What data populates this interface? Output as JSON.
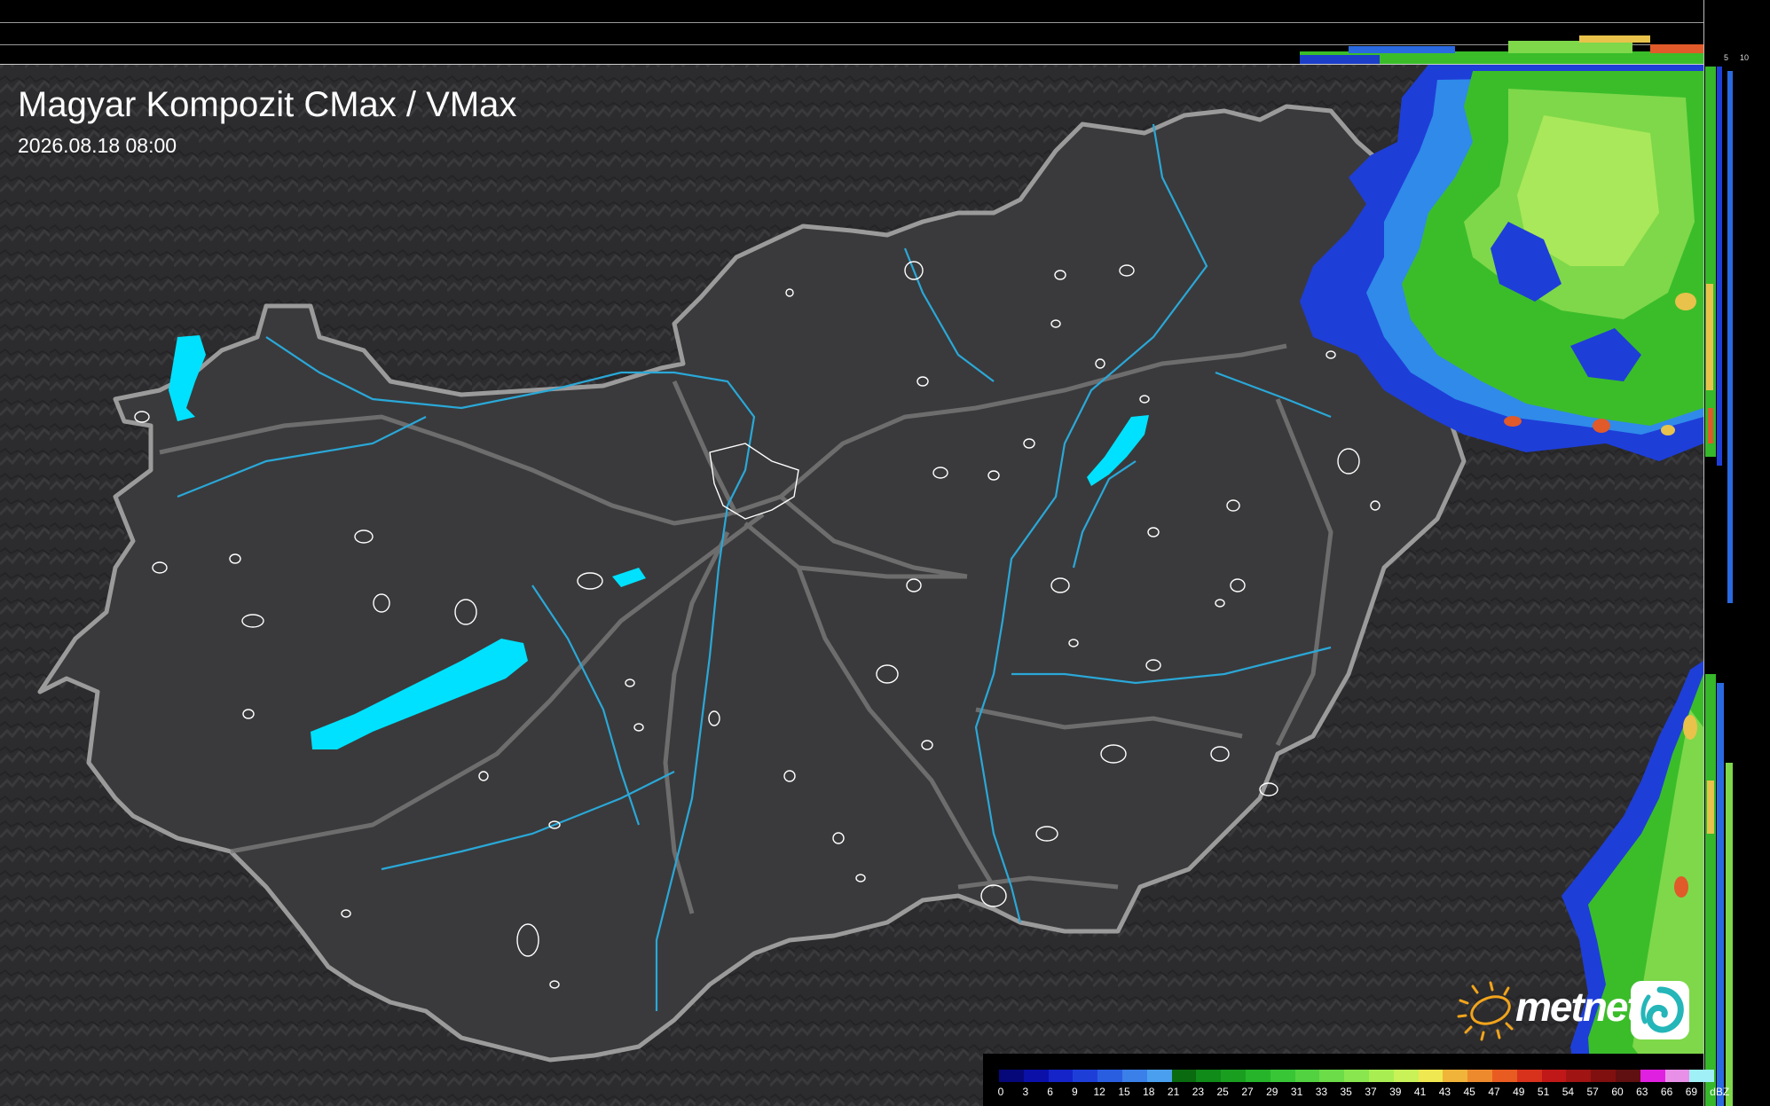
{
  "header": {
    "title": "Magyar Kompozit CMax / VMax",
    "timestamp": "2026.08.18 08:00"
  },
  "profile_axes": {
    "top_ticks": [
      "10",
      "5"
    ],
    "right_ticks": [
      "5",
      "10"
    ]
  },
  "brand": {
    "logo_text": "metnet"
  },
  "legend": {
    "unit": "dBZ",
    "values": [
      "0",
      "3",
      "6",
      "9",
      "12",
      "15",
      "18",
      "21",
      "23",
      "25",
      "27",
      "29",
      "31",
      "33",
      "35",
      "37",
      "39",
      "41",
      "43",
      "45",
      "47",
      "49",
      "51",
      "54",
      "57",
      "60",
      "63",
      "66",
      "69"
    ],
    "colors": [
      "#06087a",
      "#0a10a8",
      "#1424c8",
      "#1e3ed8",
      "#2a5ee0",
      "#3a80e8",
      "#4aa0ee",
      "#0a6a10",
      "#108a18",
      "#1a9e20",
      "#26b42a",
      "#38c636",
      "#52d240",
      "#6cdc48",
      "#8ae64e",
      "#a8ee52",
      "#c8f258",
      "#f0e850",
      "#f0b43a",
      "#ee8a2e",
      "#e85c22",
      "#d8321c",
      "#c01818",
      "#a01414",
      "#801010",
      "#601010",
      "#e020e0",
      "#e890e8",
      "#a0f0f8"
    ]
  },
  "colors": {
    "lake": "#00e1ff",
    "river": "#2aa8d8",
    "border": "#9b9b9b",
    "roads": "#7a7a7a",
    "settlement_outline": "#ffffff",
    "land": "#3a3a3c",
    "outside": "#2c2c2e"
  },
  "icons": [
    "sun-logo-icon",
    "spiral-badge-icon"
  ]
}
